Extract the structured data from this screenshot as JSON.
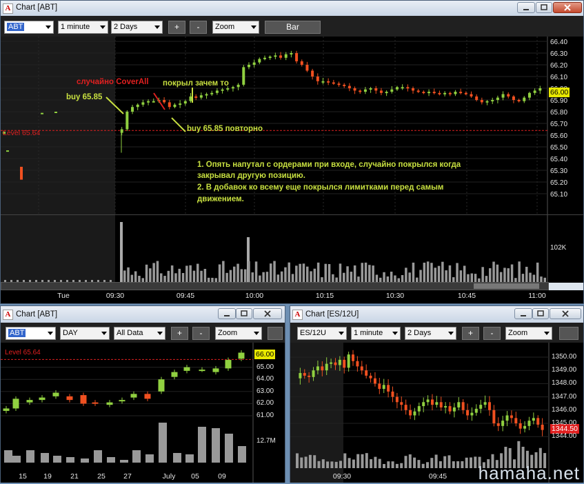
{
  "main": {
    "title": "Chart [ABT]",
    "symbol": "ABT",
    "interval": "1 minute",
    "range": "2 Days",
    "plus_label": "+",
    "minus_label": "-",
    "zoom_label": "Zoom",
    "bar_label": "Bar",
    "level_label": "Level 65.64",
    "price_tag": "66.00",
    "volume_tick": "102K",
    "y_ticks": [
      "66.40",
      "66.30",
      "66.20",
      "66.10",
      "66.00",
      "65.90",
      "65.80",
      "65.70",
      "65.60",
      "65.50",
      "65.40",
      "65.30",
      "65.20",
      "65.10"
    ],
    "x_ticks": [
      "Tue",
      "09:30",
      "09:45",
      "10:00",
      "10:15",
      "10:30",
      "10:45",
      "11:00"
    ],
    "annotations": {
      "cover_all": "случайно CoverAll",
      "covered": "покрыл зачем то",
      "buy1": "buy 65.85",
      "buy2": "buy 65.85 повторно",
      "note1": "1. Опять напутал с ордерами при входе, случайно покрылся когда",
      "note1b": "закрывал другую позицию.",
      "note2": "2. В добавок ко всему еще покрылся лимитками перед самым",
      "note2b": "движением."
    },
    "colors": {
      "up": "#90d040",
      "down": "#f05020",
      "level": "#e02020",
      "annot_green": "#c8e040",
      "annot_red": "#e02020",
      "note_green": "#c8e040"
    }
  },
  "daily": {
    "title": "Chart [ABT]",
    "symbol": "ABT",
    "interval": "DAY",
    "range": "All Data",
    "plus_label": "+",
    "minus_label": "-",
    "zoom_label": "Zoom",
    "level_label": "Level 65.64",
    "price_tag": "66.00",
    "volume_tick": "12.7M",
    "y_ticks": [
      "65.00",
      "64.00",
      "63.00",
      "62.00",
      "61.00"
    ],
    "x_ticks": [
      "15",
      "19",
      "21",
      "25",
      "27",
      "July",
      "05",
      "09"
    ]
  },
  "es": {
    "title": "Chart [ES/12U]",
    "symbol": "ES/12U",
    "interval": "1 minute",
    "range": "2 Days",
    "plus_label": "+",
    "minus_label": "-",
    "zoom_label": "Zoom",
    "price_tag": "1344.50",
    "y_ticks": [
      "1350.00",
      "1349.00",
      "1348.00",
      "1347.00",
      "1346.00",
      "1345.00",
      "1344.00"
    ],
    "x_ticks": [
      "09:30",
      "09:45"
    ]
  },
  "watermark": "hamaha.net"
}
